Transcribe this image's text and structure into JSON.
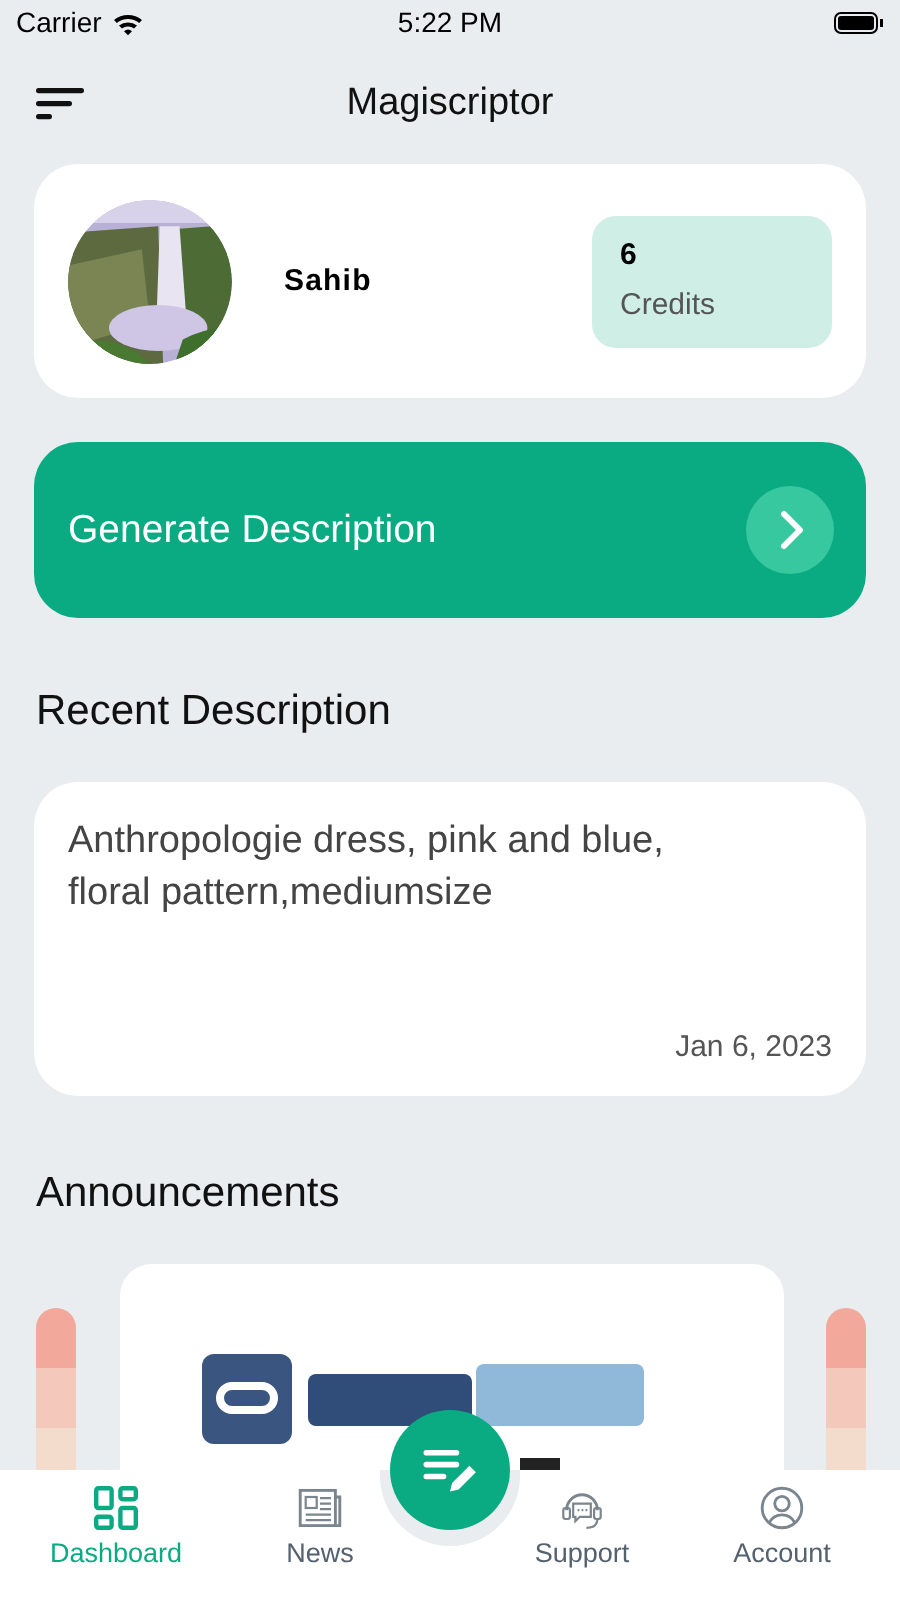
{
  "status_bar": {
    "carrier": "Carrier",
    "time": "5:22 PM"
  },
  "header": {
    "title": "Magiscriptor"
  },
  "profile": {
    "name": "Sahib",
    "credits_value": "6",
    "credits_label": "Credits"
  },
  "generate_button": {
    "label": "Generate Description"
  },
  "recent": {
    "heading": "Recent Description",
    "items": [
      {
        "text": "Anthropologie dress, pink and blue, floral pattern,mediumsize",
        "date": "Jan 6, 2023"
      }
    ]
  },
  "announcements": {
    "heading": "Announcements"
  },
  "bottom_nav": [
    {
      "label": "Dashboard",
      "selected": true
    },
    {
      "label": "News",
      "selected": false
    },
    {
      "label": "Support",
      "selected": false
    },
    {
      "label": "Account",
      "selected": false
    }
  ]
}
